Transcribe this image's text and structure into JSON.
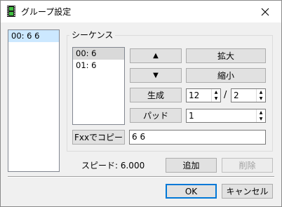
{
  "window": {
    "title": "グループ設定",
    "icon": "film-strip-icon"
  },
  "group_list": {
    "items": [
      "00: 6 6"
    ],
    "selected_index": 0
  },
  "sequence": {
    "label": "シーケンス",
    "items": [
      "00: 6",
      "01: 6"
    ],
    "selected_index": 0,
    "up_button_glyph": "▲",
    "down_button_glyph": "▼",
    "expand_label": "拡大",
    "shrink_label": "縮小",
    "generate_label": "生成",
    "generate_value_a": "12",
    "slash": "/",
    "generate_value_b": "2",
    "pad_label": "パッド",
    "pad_value": "1",
    "copy_fxx_label": "Fxxでコピー",
    "fxx_value": "6 6"
  },
  "speed_text": "スピード: 6.000",
  "add_label": "追加",
  "delete_label": "削除",
  "ok_label": "OK",
  "cancel_label": "キャンセル",
  "colors": {
    "accent": "#0078d7",
    "selection": "#cce8ff"
  }
}
